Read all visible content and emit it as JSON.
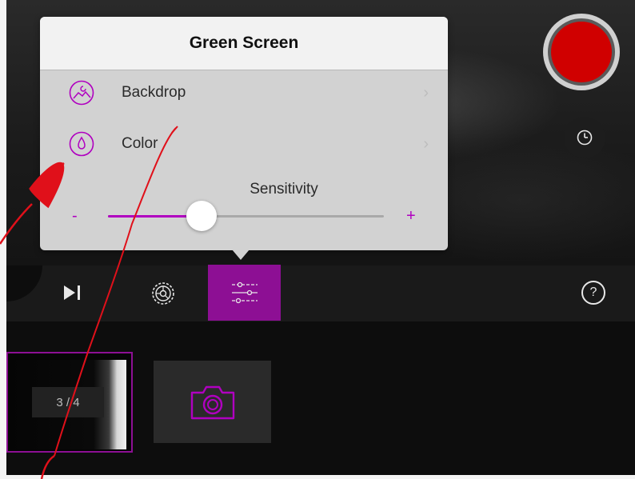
{
  "popover": {
    "title": "Green Screen",
    "items": [
      {
        "label": "Backdrop",
        "icon": "image-icon",
        "chevron": "›"
      },
      {
        "label": "Color",
        "icon": "droplet-icon",
        "chevron": "›"
      }
    ],
    "sensitivity": {
      "label": "Sensitivity",
      "minus": "-",
      "plus": "+",
      "value_fraction": 0.34
    }
  },
  "toolbar": {
    "next_icon": "skip-forward-icon",
    "settings_icon": "gear-icon",
    "adjust_icon": "sliders-icon",
    "help_label": "?"
  },
  "clips": {
    "counter": "3 / 4",
    "camera_icon": "camera-icon"
  },
  "colors": {
    "accent": "#8d0f94",
    "record": "#d00000",
    "annotation": "#e0101a"
  }
}
